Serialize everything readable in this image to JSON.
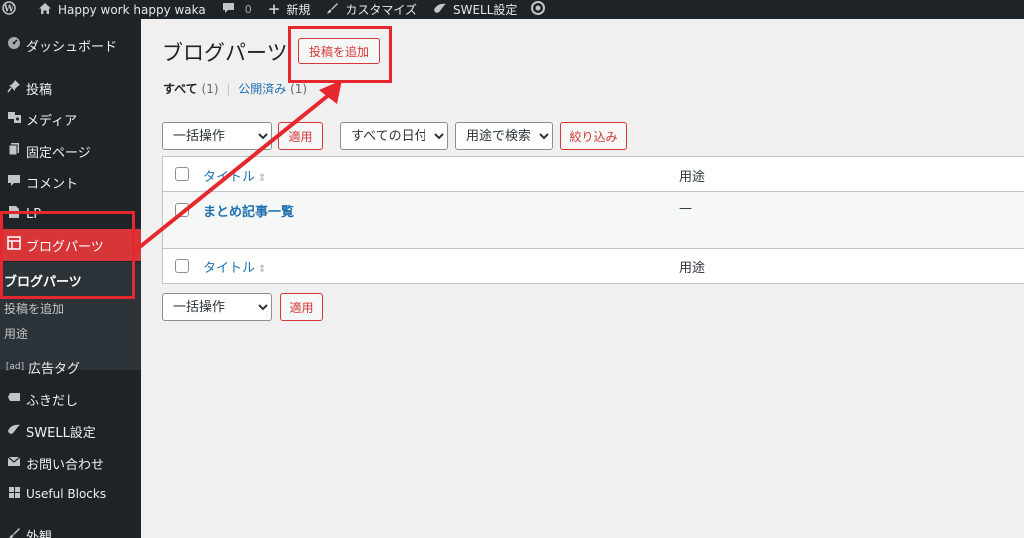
{
  "adminbar": {
    "site_name": "Happy work happy waka",
    "comment_count": "0",
    "new_label": "新規",
    "customize_label": "カスタマイズ",
    "swell_label": "SWELL設定"
  },
  "sidebar": {
    "items": [
      {
        "label": "ダッシュボード",
        "icon": "gauge-icon"
      },
      {
        "label": "投稿",
        "icon": "pin-icon"
      },
      {
        "label": "メディア",
        "icon": "media-icon"
      },
      {
        "label": "固定ページ",
        "icon": "page-icon"
      },
      {
        "label": "コメント",
        "icon": "comment-icon"
      },
      {
        "label": "LP",
        "icon": "document-icon"
      },
      {
        "label": "ブログパーツ",
        "icon": "layout-icon"
      },
      {
        "label": "広告タグ",
        "icon": "ad-icon"
      },
      {
        "label": "ふきだし",
        "icon": "speech-icon"
      },
      {
        "label": "SWELL設定",
        "icon": "swell-icon"
      },
      {
        "label": "お問い合わせ",
        "icon": "mail-icon"
      },
      {
        "label": "Useful Blocks",
        "icon": "blocks-icon"
      },
      {
        "label": "外観",
        "icon": "brush-icon"
      }
    ],
    "submenu": [
      {
        "label": "ブログパーツ"
      },
      {
        "label": "投稿を追加"
      },
      {
        "label": "用途"
      }
    ],
    "ad_icon_text": "[ad]"
  },
  "main": {
    "title": "ブログパーツ",
    "add_new_label": "投稿を追加",
    "views": {
      "all_label": "すべて",
      "all_count": "(1)",
      "separator": "|",
      "published_label": "公開済み",
      "published_count": "(1)"
    },
    "bulk_action": "一括操作",
    "apply_label": "適用",
    "date_filter": "すべての日付",
    "use_filter": "用途で検索",
    "filter_button": "絞り込み",
    "columns": {
      "title": "タイトル",
      "use": "用途"
    },
    "rows": [
      {
        "title": "まとめ記事一覧",
        "use": "—"
      }
    ]
  },
  "annotation": {
    "color": "#e6282e"
  },
  "colors": {
    "accent": "#d63638",
    "link": "#2271b1",
    "sidebar_bg": "#1d2327"
  }
}
